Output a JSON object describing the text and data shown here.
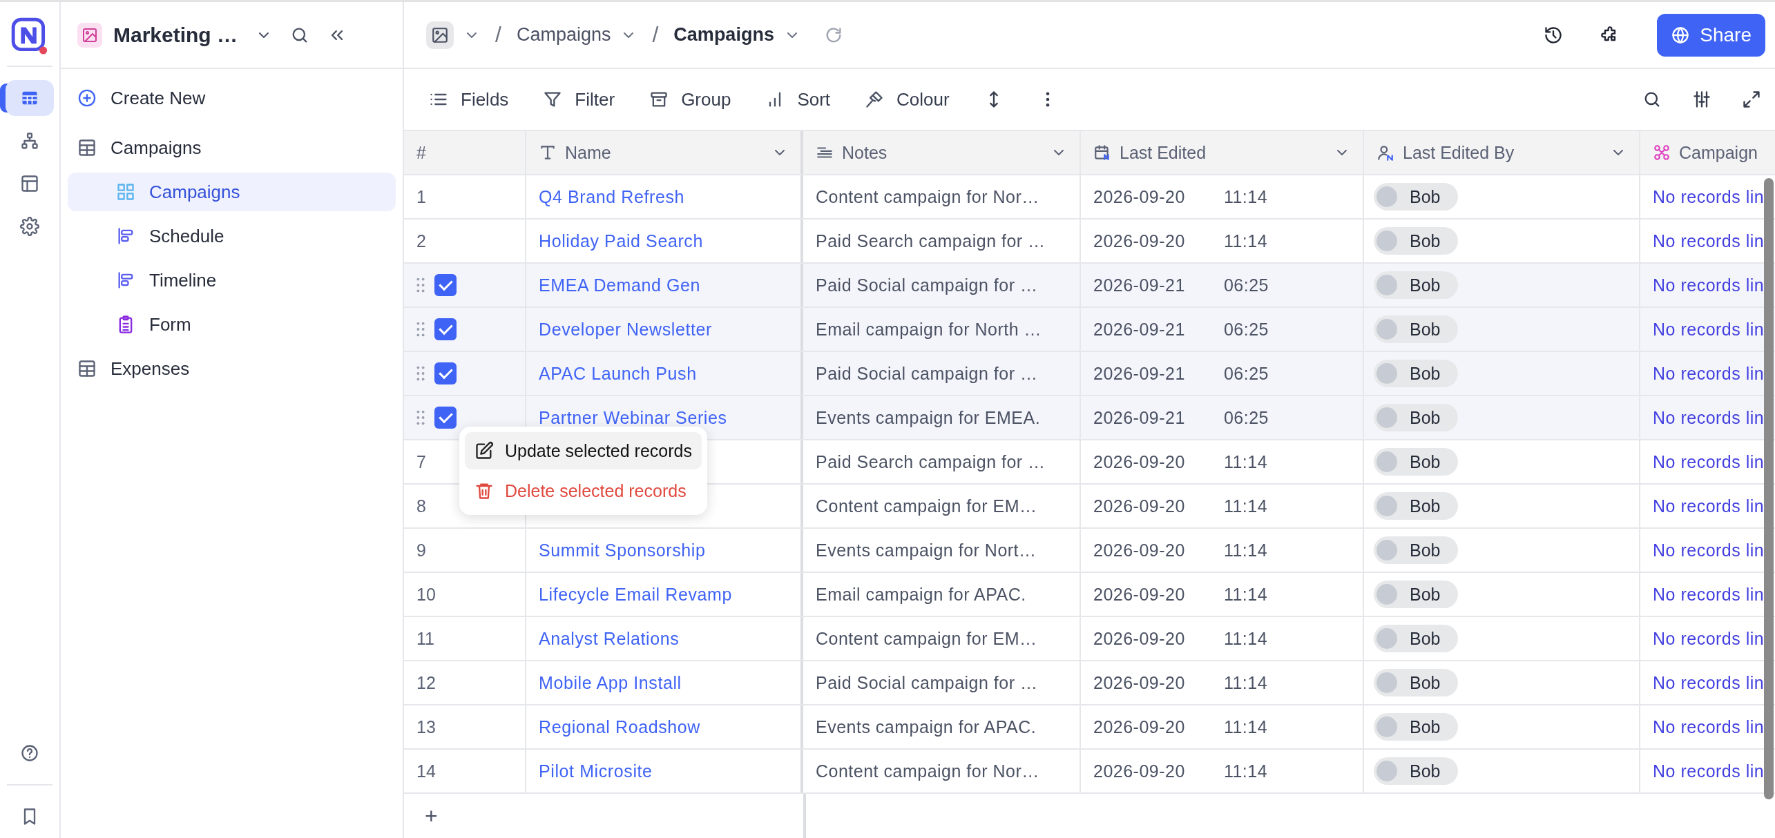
{
  "rail": {
    "items": [
      {
        "kind": "grid",
        "selected": true
      },
      {
        "kind": "sitemap",
        "selected": false
      },
      {
        "kind": "layout",
        "selected": false
      },
      {
        "kind": "settings",
        "selected": false
      }
    ],
    "bottom": [
      {
        "kind": "help"
      },
      {
        "kind": "bookmark"
      }
    ]
  },
  "sidebar": {
    "base_title": "Marketing …",
    "create_label": "Create New",
    "tree": [
      {
        "kind": "table",
        "label": "Campaigns",
        "selected": false,
        "children": [
          {
            "kind": "grid",
            "label": "Campaigns",
            "selected": true
          },
          {
            "kind": "calendar",
            "label": "Schedule",
            "selected": false
          },
          {
            "kind": "timeline",
            "label": "Timeline",
            "selected": false
          },
          {
            "kind": "form",
            "label": "Form",
            "selected": false
          }
        ]
      },
      {
        "kind": "table",
        "label": "Expenses",
        "selected": false
      }
    ]
  },
  "breadcrumb": [
    {
      "separator": "/",
      "label": "Campaigns",
      "selected": false
    },
    {
      "separator": "/",
      "label": "Campaigns",
      "selected": true
    }
  ],
  "share_label": "Share",
  "toolbar": [
    {
      "kind": "fields",
      "label": "Fields"
    },
    {
      "kind": "filter",
      "label": "Filter"
    },
    {
      "kind": "group",
      "label": "Group"
    },
    {
      "kind": "sort",
      "label": "Sort"
    },
    {
      "kind": "colour",
      "label": "Colour"
    },
    {
      "kind": "row-height"
    },
    {
      "kind": "more"
    }
  ],
  "table": {
    "columns": [
      {
        "kind": "number",
        "label": "#",
        "has_menu": false
      },
      {
        "kind": "text",
        "label": "Name",
        "has_menu": true
      },
      {
        "kind": "longtext",
        "label": "Notes",
        "has_menu": true
      },
      {
        "kind": "date",
        "label": "Last Edited",
        "has_menu": true
      },
      {
        "kind": "user",
        "label": "Last Edited By",
        "has_menu": true
      },
      {
        "kind": "link",
        "label": "Campaign",
        "has_menu": false
      }
    ],
    "rows": [
      {
        "number": "1",
        "name": "Q4 Brand Refresh",
        "notes": "Content campaign for Nor…",
        "date": "2026-09-20",
        "time": "11:14",
        "editor": "Bob",
        "campaign": "No records lin",
        "selected": false
      },
      {
        "number": "2",
        "name": "Holiday Paid Search",
        "notes": "Paid Search campaign for …",
        "date": "2026-09-20",
        "time": "11:14",
        "editor": "Bob",
        "campaign": "No records lin",
        "selected": false
      },
      {
        "name": "EMEA Demand Gen",
        "notes": "Paid Social campaign for …",
        "date": "2026-09-21",
        "time": "06:25",
        "editor": "Bob",
        "campaign": "No records lin",
        "selected": true
      },
      {
        "name": "Developer Newsletter",
        "notes": "Email campaign for North …",
        "date": "2026-09-21",
        "time": "06:25",
        "editor": "Bob",
        "campaign": "No records lin",
        "selected": true
      },
      {
        "name": "APAC Launch Push",
        "notes": "Paid Social campaign for …",
        "date": "2026-09-21",
        "time": "06:25",
        "editor": "Bob",
        "campaign": "No records lin",
        "selected": true
      },
      {
        "name": "Partner Webinar Series",
        "notes": "Events campaign for EMEA.",
        "date": "2026-09-21",
        "time": "06:25",
        "editor": "Bob",
        "campaign": "No records lin",
        "selected": true
      },
      {
        "number": "7",
        "notes": "Paid Search campaign for …",
        "date": "2026-09-20",
        "time": "11:14",
        "editor": "Bob",
        "campaign": "No records lin",
        "selected": false
      },
      {
        "number": "8",
        "notes": "Content campaign for EM…",
        "date": "2026-09-20",
        "time": "11:14",
        "editor": "Bob",
        "campaign": "No records lin",
        "selected": false
      },
      {
        "number": "9",
        "name": "Summit Sponsorship",
        "notes": "Events campaign for Nort…",
        "date": "2026-09-20",
        "time": "11:14",
        "editor": "Bob",
        "campaign": "No records lin",
        "selected": false
      },
      {
        "number": "10",
        "name": "Lifecycle Email Revamp",
        "notes": "Email campaign for APAC.",
        "date": "2026-09-20",
        "time": "11:14",
        "editor": "Bob",
        "campaign": "No records lin",
        "selected": false
      },
      {
        "number": "11",
        "name": "Analyst Relations",
        "notes": "Content campaign for EM…",
        "date": "2026-09-20",
        "time": "11:14",
        "editor": "Bob",
        "campaign": "No records lin",
        "selected": false
      },
      {
        "number": "12",
        "name": "Mobile App Install",
        "notes": "Paid Social campaign for …",
        "date": "2026-09-20",
        "time": "11:14",
        "editor": "Bob",
        "campaign": "No records lin",
        "selected": false
      },
      {
        "number": "13",
        "name": "Regional Roadshow",
        "notes": "Events campaign for APAC.",
        "date": "2026-09-20",
        "time": "11:14",
        "editor": "Bob",
        "campaign": "No records lin",
        "selected": false
      },
      {
        "number": "14",
        "name": "Pilot Microsite",
        "notes": "Content campaign for Nor…",
        "date": "2026-09-20",
        "time": "11:14",
        "editor": "Bob",
        "campaign": "No records lin",
        "selected": false
      }
    ],
    "add_label": "+"
  },
  "context_menu": {
    "items": [
      {
        "kind": "edit",
        "label": "Update selected records",
        "highlighted": true
      },
      {
        "kind": "delete",
        "label": "Delete selected records",
        "highlighted": false
      }
    ]
  }
}
